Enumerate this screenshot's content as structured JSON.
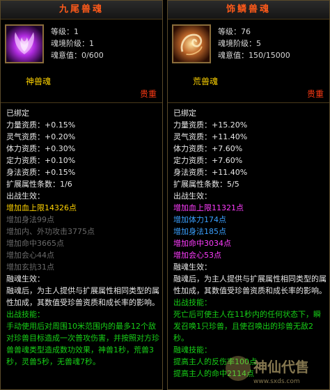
{
  "left": {
    "title": "九尾兽魂",
    "stats": [
      "等级：1",
      "魂境阶级：1",
      "魂意值：0/600"
    ],
    "type_name": "神兽魂",
    "rarity": "贵重",
    "bound": "已绑定",
    "aptitudes": [
      "力量资质：+0.15%",
      "灵气资质：+0.20%",
      "体力资质：+0.30%",
      "定力资质：+0.10%",
      "身法资质：+0.15%",
      "扩展属性条数：1/6"
    ],
    "battle_header": "出战生效：",
    "battle_items": [
      {
        "text": "增加血上限14326点",
        "style": "g"
      },
      {
        "text": "增加身法99点",
        "style": "gr"
      },
      {
        "text": "增加内、外功攻击3775点",
        "style": "gr"
      },
      {
        "text": "增加命中3665点",
        "style": "gr"
      },
      {
        "text": "增加会心44点",
        "style": "gr"
      },
      {
        "text": "增加玄抗31点",
        "style": "gr"
      }
    ],
    "fusion_header": "融魂生效：",
    "fusion_text": "融魂后，为主人提供与扩展属性相同类型的属性加成，其数值受珍兽资质和成长率的影响。",
    "skill_header": "出战技能：",
    "skill_text": "手动使用后对周围10米范围内的最多12个敌对珍兽目标造成一次普攻伤害，并按照对方珍兽兽魂类型造成数功效果，神兽1秒，荒兽3秒，灵兽5秒，无兽魂7秒。"
  },
  "right": {
    "title": "饰鳞兽魂",
    "stats": [
      "等级：76",
      "魂境阶级：5",
      "魂意值：150/15000"
    ],
    "type_name": "荒兽魂",
    "rarity": "贵重",
    "bound": "已绑定",
    "aptitudes": [
      "力量资质：+15.20%",
      "灵气资质：+11.40%",
      "体力资质：+7.60%",
      "定力资质：+7.60%",
      "身法资质：+11.40%",
      "扩展属性条数：5/5"
    ],
    "battle_header": "出战生效：",
    "battle_items": [
      {
        "text": "增加血上限11321点",
        "style": "pink"
      },
      {
        "text": "增加体力174点",
        "style": "blue"
      },
      {
        "text": "增加身法185点",
        "style": "blue"
      },
      {
        "text": "增加命中3034点",
        "style": "pink"
      },
      {
        "text": "增加会心53点",
        "style": "pink"
      }
    ],
    "fusion_header": "融魂生效：",
    "fusion_text": "融魂后，为主人提供与扩展属性相同类型的属性加成，其数值受珍兽资质和成长率的影响。",
    "skill_header": "出战技能：",
    "skill_text": "死亡后可使主人在11秒内的任何状态下，瞬发召唤1只珍兽，且使召唤出的珍兽无敌2秒。",
    "fusion_skill_header": "融魂技能：",
    "fusion_skill_items": [
      "提高主人的反伤率100点",
      "提高主人的命中2114点"
    ]
  },
  "watermark": {
    "text": "神仙代售",
    "url_text": "www.sxds.com"
  }
}
